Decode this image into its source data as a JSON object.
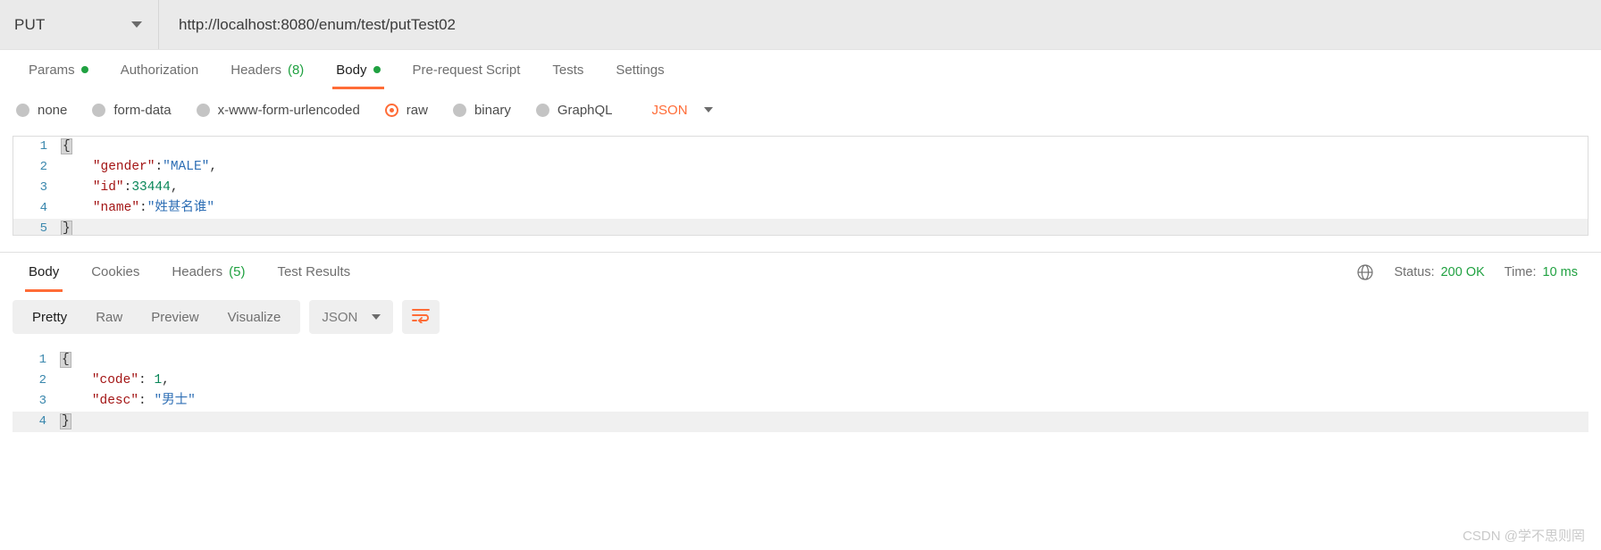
{
  "urlbar": {
    "method": "PUT",
    "method_caret_icon": "chevron-down-icon",
    "url": "http://localhost:8080/enum/test/putTest02"
  },
  "request_tabs": [
    {
      "label": "Params",
      "indicator": "dot",
      "active": false
    },
    {
      "label": "Authorization",
      "indicator": "none",
      "active": false
    },
    {
      "label": "Headers",
      "indicator": "count",
      "count": "(8)",
      "active": false
    },
    {
      "label": "Body",
      "indicator": "dot",
      "active": true
    },
    {
      "label": "Pre-request Script",
      "indicator": "none",
      "active": false
    },
    {
      "label": "Tests",
      "indicator": "none",
      "active": false
    },
    {
      "label": "Settings",
      "indicator": "none",
      "active": false
    }
  ],
  "body_types": {
    "options": [
      {
        "label": "none",
        "selected": false
      },
      {
        "label": "form-data",
        "selected": false
      },
      {
        "label": "x-www-form-urlencoded",
        "selected": false
      },
      {
        "label": "raw",
        "selected": true
      },
      {
        "label": "binary",
        "selected": false
      },
      {
        "label": "GraphQL",
        "selected": false
      }
    ],
    "format_label": "JSON",
    "format_caret_icon": "chevron-down-icon"
  },
  "request_body": {
    "lines": [
      {
        "num": "1",
        "segments": [
          {
            "t": "{",
            "c": "brace"
          }
        ]
      },
      {
        "num": "2",
        "segments": [
          {
            "t": "    ",
            "c": "plain"
          },
          {
            "t": "\"gender\"",
            "c": "key"
          },
          {
            "t": ":",
            "c": "punc"
          },
          {
            "t": "\"MALE\"",
            "c": "str"
          },
          {
            "t": ",",
            "c": "punc"
          }
        ]
      },
      {
        "num": "3",
        "segments": [
          {
            "t": "    ",
            "c": "plain"
          },
          {
            "t": "\"id\"",
            "c": "key"
          },
          {
            "t": ":",
            "c": "punc"
          },
          {
            "t": "33444",
            "c": "num"
          },
          {
            "t": ",",
            "c": "punc"
          }
        ]
      },
      {
        "num": "4",
        "segments": [
          {
            "t": "    ",
            "c": "plain"
          },
          {
            "t": "\"name\"",
            "c": "key"
          },
          {
            "t": ":",
            "c": "punc"
          },
          {
            "t": "\"姓甚名谁\"",
            "c": "str"
          }
        ]
      },
      {
        "num": "5",
        "segments": [
          {
            "t": "}",
            "c": "brace"
          }
        ]
      }
    ]
  },
  "response_tabs": [
    {
      "label": "Body",
      "indicator": "none",
      "active": true
    },
    {
      "label": "Cookies",
      "indicator": "none",
      "active": false
    },
    {
      "label": "Headers",
      "indicator": "count",
      "count": "(5)",
      "active": false
    },
    {
      "label": "Test Results",
      "indicator": "none",
      "active": false
    }
  ],
  "response_meta": {
    "globe_icon": "globe-icon",
    "status_label": "Status:",
    "status_value": "200 OK",
    "time_label": "Time:",
    "time_value": "10 ms"
  },
  "response_toolbar": {
    "views": [
      {
        "label": "Pretty",
        "active": true
      },
      {
        "label": "Raw",
        "active": false
      },
      {
        "label": "Preview",
        "active": false
      },
      {
        "label": "Visualize",
        "active": false
      }
    ],
    "format_label": "JSON",
    "format_caret_icon": "chevron-down-icon",
    "wrap_icon": "wrap-lines-icon"
  },
  "response_body": {
    "lines": [
      {
        "num": "1",
        "segments": [
          {
            "t": "{",
            "c": "brace"
          }
        ]
      },
      {
        "num": "2",
        "segments": [
          {
            "t": "    ",
            "c": "plain"
          },
          {
            "t": "\"code\"",
            "c": "key"
          },
          {
            "t": ": ",
            "c": "punc"
          },
          {
            "t": "1",
            "c": "num"
          },
          {
            "t": ",",
            "c": "punc"
          }
        ]
      },
      {
        "num": "3",
        "segments": [
          {
            "t": "    ",
            "c": "plain"
          },
          {
            "t": "\"desc\"",
            "c": "key"
          },
          {
            "t": ": ",
            "c": "punc"
          },
          {
            "t": "\"男士\"",
            "c": "str"
          }
        ]
      },
      {
        "num": "4",
        "segments": [
          {
            "t": "}",
            "c": "brace"
          }
        ]
      }
    ]
  },
  "watermark": "CSDN @学不思则罔",
  "colors": {
    "accent": "#ff6c37",
    "success": "#20a141",
    "key": "#a31515",
    "string": "#2f6fb5",
    "number": "#098658",
    "linenum": "#3a87ad"
  }
}
